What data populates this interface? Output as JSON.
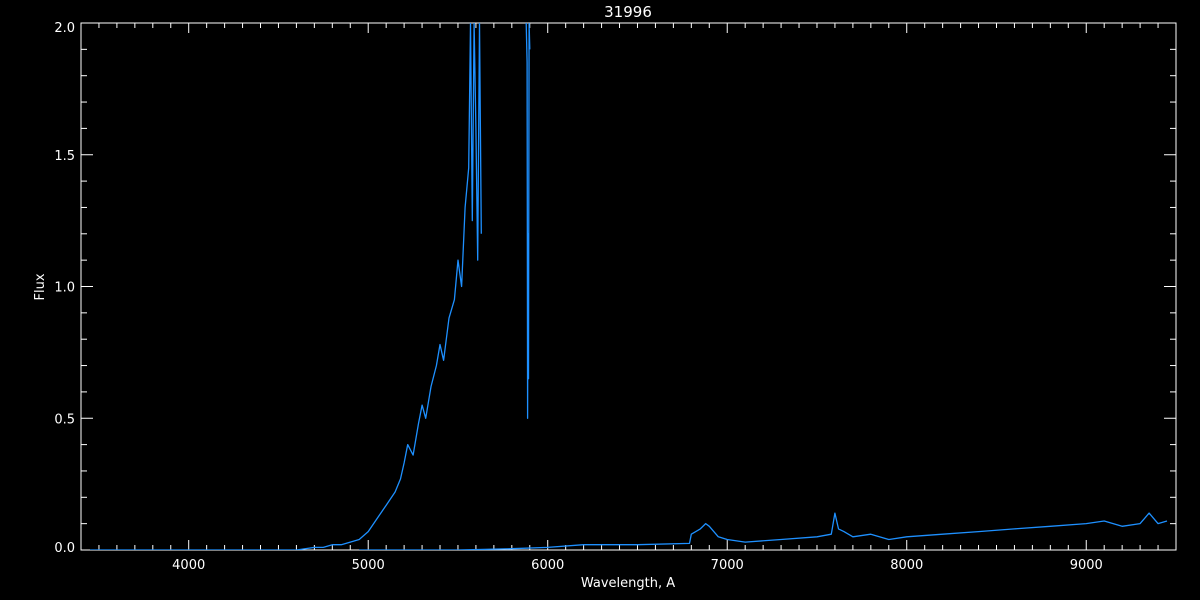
{
  "chart_data": {
    "type": "line",
    "title": "31996",
    "xlabel": "Wavelength, A",
    "ylabel": "Flux",
    "xlim": [
      3400,
      9500
    ],
    "ylim": [
      0,
      2.0
    ],
    "x_ticks": [
      4000,
      5000,
      6000,
      7000,
      8000,
      9000
    ],
    "x_tick_labels": [
      "4000",
      "5000",
      "6000",
      "7000",
      "8000",
      "9000"
    ],
    "y_ticks": [
      0,
      0.5,
      1.0,
      1.5,
      2.0
    ],
    "y_tick_labels": [
      "0.0",
      "0.5",
      "1.0",
      "1.5",
      "2.0"
    ],
    "grid": false,
    "line_color": "#1e90ff",
    "axis_color": "#ffffff",
    "background": "#000000",
    "series": [
      {
        "segment": "blue-arm",
        "x": [
          3450,
          3600,
          3800,
          4000,
          4200,
          4400,
          4600,
          4700,
          4750,
          4800,
          4850,
          4900,
          4950,
          5000,
          5050,
          5100,
          5150,
          5180,
          5200,
          5220,
          5250,
          5280,
          5300,
          5320,
          5350,
          5380,
          5400,
          5420,
          5450,
          5480,
          5500,
          5520,
          5540,
          5560,
          5570,
          5580,
          5590,
          5600,
          5610,
          5620,
          5630
        ],
        "y": [
          0.0,
          0.0,
          0.0,
          0.0,
          0.0,
          0.0,
          0.0,
          0.01,
          0.01,
          0.02,
          0.02,
          0.03,
          0.04,
          0.07,
          0.12,
          0.17,
          0.22,
          0.27,
          0.33,
          0.4,
          0.36,
          0.48,
          0.55,
          0.5,
          0.62,
          0.7,
          0.78,
          0.72,
          0.88,
          0.95,
          1.1,
          1.0,
          1.3,
          1.45,
          2.0,
          1.25,
          2.0,
          1.6,
          1.1,
          2.0,
          1.2
        ]
      },
      {
        "segment": "na-feature",
        "x": [
          5880,
          5885,
          5888,
          5890,
          5893,
          5896,
          5900
        ],
        "y": [
          2.0,
          1.85,
          0.5,
          1.2,
          0.65,
          2.0,
          1.9
        ]
      },
      {
        "segment": "red-arm",
        "x": [
          4950,
          5200,
          5500,
          5800,
          6000,
          6200,
          6500,
          6790,
          6800,
          6850,
          6880,
          6900,
          6950,
          7000,
          7100,
          7300,
          7500,
          7580,
          7600,
          7620,
          7650,
          7700,
          7800,
          7900,
          8000,
          8200,
          8400,
          8600,
          8800,
          9000,
          9100,
          9200,
          9300,
          9350,
          9400,
          9450
        ],
        "y": [
          0.0,
          0.0,
          0.0,
          0.005,
          0.01,
          0.02,
          0.02,
          0.025,
          0.06,
          0.08,
          0.1,
          0.09,
          0.05,
          0.04,
          0.03,
          0.04,
          0.05,
          0.06,
          0.14,
          0.08,
          0.07,
          0.05,
          0.06,
          0.04,
          0.05,
          0.06,
          0.07,
          0.08,
          0.09,
          0.1,
          0.11,
          0.09,
          0.1,
          0.14,
          0.1,
          0.11
        ]
      }
    ]
  }
}
